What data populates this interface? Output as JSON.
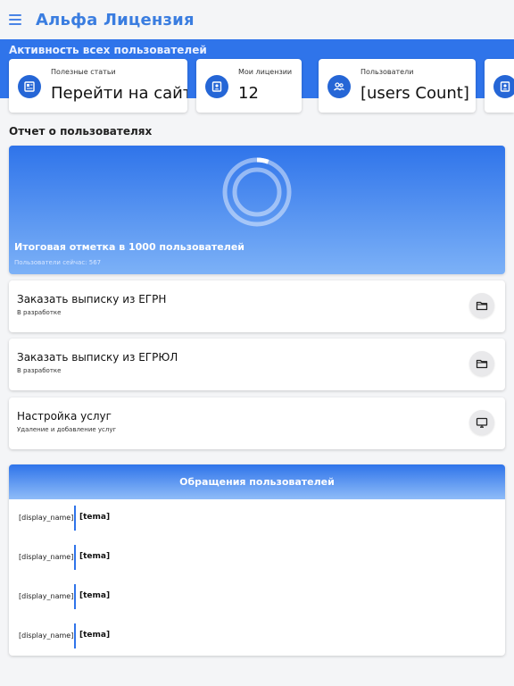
{
  "app": {
    "title": "Альфа Лицензия"
  },
  "activity": {
    "title": "Активность всех пользователей",
    "cards": [
      {
        "icon": "newspaper-icon",
        "label": "Полезные статьи",
        "value": "Перейти на сайт"
      },
      {
        "icon": "badge-icon",
        "label": "Мои лицензии",
        "value": "12"
      },
      {
        "icon": "group-icon",
        "label": "Пользователи",
        "value": "[users Count]"
      },
      {
        "icon": "badge-icon",
        "label": "",
        "value": ""
      }
    ]
  },
  "report": {
    "section_title": "Отчет о пользователях",
    "title": "Итоговая отметка в 1000 пользователей",
    "subtitle": "Пользователи сейчас: 567",
    "progress_fraction": 0.0567
  },
  "actions": [
    {
      "title": "Заказать выписку из ЕГРН",
      "subtitle": "В разработке",
      "icon": "folder-icon"
    },
    {
      "title": "Заказать выписку из ЕГРЮЛ",
      "subtitle": "В разработке",
      "icon": "folder-icon"
    },
    {
      "title": "Настройка услуг",
      "subtitle": "Удаление и добавлениe услуг",
      "icon": "monitor-icon"
    }
  ],
  "requests": {
    "title": "Обращения пользователей",
    "rows": [
      {
        "name": "[display_name]",
        "topic": "[tema]"
      },
      {
        "name": "[display_name]",
        "topic": "[tema]"
      },
      {
        "name": "[display_name]",
        "topic": "[tema]"
      },
      {
        "name": "[display_name]",
        "topic": "[tema]"
      }
    ]
  },
  "colors": {
    "accent": "#2f74ea",
    "title": "#3a7de0",
    "icon_bg": "#2566d6"
  }
}
